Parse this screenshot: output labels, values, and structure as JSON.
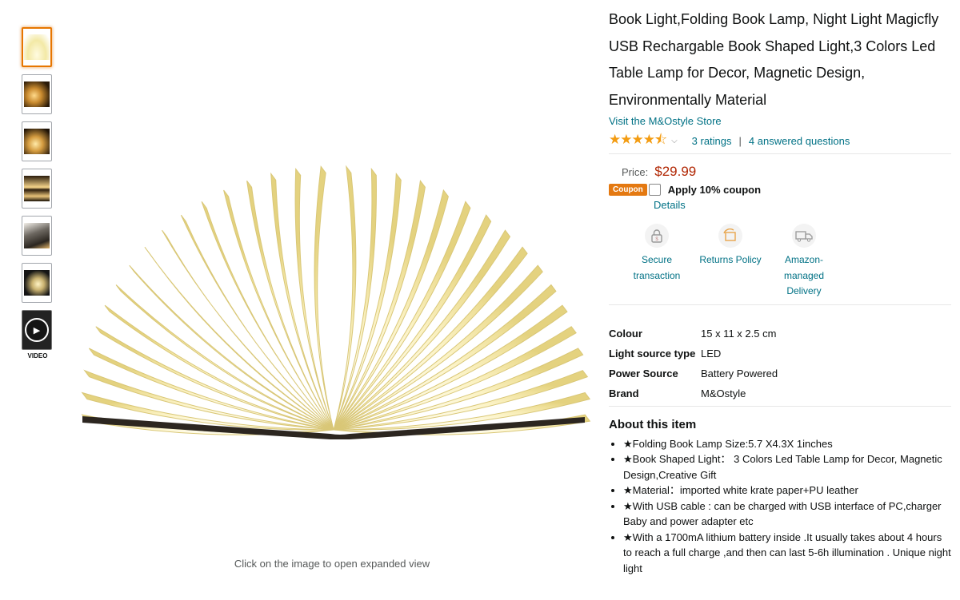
{
  "product": {
    "title": "Book Light,Folding Book Lamp, Night Light Magicfly USB Rechargable Book Shaped Light,3 Colors Led Table Lamp for Decor, Magnetic Design, Environmentally Material",
    "store_link": "Visit the M&Ostyle Store",
    "rating_stars": "★★★★⯪",
    "ratings_link": "3 ratings",
    "questions_link": "4 answered questions",
    "rating_separator": "|"
  },
  "thumbnails": {
    "video_label": "VIDEO"
  },
  "main_image": {
    "caption": "Click on the image to open expanded view"
  },
  "buybox": {
    "price_label": "Price:",
    "price": "$29.99",
    "coupon_badge": "Coupon",
    "coupon_text": "Apply 10% coupon",
    "details_link": "Details"
  },
  "features": [
    {
      "label": "Secure transaction"
    },
    {
      "label": "Returns Policy"
    },
    {
      "label": "Amazon-managed Delivery"
    }
  ],
  "specs": [
    {
      "key": "Colour",
      "value": "15 x 11 x 2.5 cm"
    },
    {
      "key": "Light source type",
      "value": "LED"
    },
    {
      "key": "Power Source",
      "value": "Battery Powered"
    },
    {
      "key": "Brand",
      "value": "M&Ostyle"
    }
  ],
  "about": {
    "title": "About this item",
    "bullets": [
      "★Folding Book Lamp Size:5.7 X4.3X 1inches",
      "★Book Shaped Light： 3 Colors Led Table Lamp for Decor, Magnetic Design,Creative Gift",
      "★Material：imported white krate paper+PU leather",
      "★With USB cable : can be charged with USB interface of PC,charger Baby and power adapter etc",
      "★With a 1700mA lithium battery inside .It usually takes about 4 hours to reach a full charge ,and then can last 5-6h illumination . Unique night light"
    ]
  },
  "colors": {
    "link": "#007185",
    "price": "#b12704",
    "coupon": "#e47911",
    "star": "#f39c12",
    "active_thumb_border": "#e77600"
  }
}
